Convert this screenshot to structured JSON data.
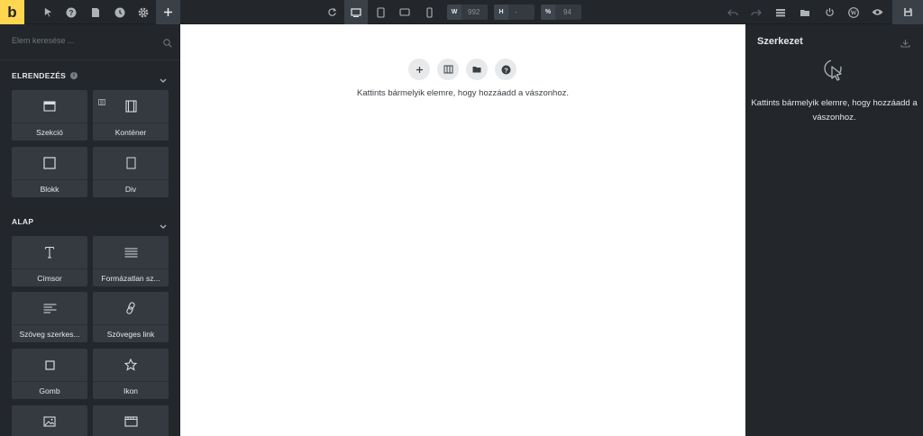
{
  "app": {
    "logo_letter": "b",
    "accent": "#ffd64f"
  },
  "topbar": {
    "left_icons": [
      "pointer-icon",
      "help-icon",
      "pages-icon",
      "history-icon",
      "settings-icon",
      "add-icon"
    ],
    "center_icons": [
      "undo-reload-icon",
      "desktop-icon",
      "tablet-portrait-icon",
      "tablet-landscape-icon",
      "mobile-icon"
    ],
    "width": {
      "label": "W",
      "value": "992"
    },
    "height": {
      "label": "H",
      "value": "-"
    },
    "zoom": {
      "label": "%",
      "value": "94"
    },
    "right_icons": [
      "undo-icon",
      "redo-icon",
      "structure-icon",
      "folder-icon",
      "power-icon",
      "wordpress-icon",
      "preview-icon",
      "save-icon"
    ]
  },
  "sidebar": {
    "search": {
      "placeholder": "Elem keresése ..."
    },
    "sections": [
      {
        "title": "ELRENDEZÉS",
        "items": [
          {
            "label": "Szekció",
            "icon": "section-icon"
          },
          {
            "label": "Konténer",
            "icon": "container-icon"
          },
          {
            "label": "Blokk",
            "icon": "block-icon"
          },
          {
            "label": "Div",
            "icon": "div-icon"
          }
        ]
      },
      {
        "title": "ALAP",
        "items": [
          {
            "label": "Címsor",
            "icon": "heading-icon"
          },
          {
            "label": "Formázatlan sz...",
            "icon": "text-lines-icon"
          },
          {
            "label": "Szöveg szerkes...",
            "icon": "rich-text-icon"
          },
          {
            "label": "Szöveges link",
            "icon": "link-icon"
          },
          {
            "label": "Gomb",
            "icon": "button-icon"
          },
          {
            "label": "Ikon",
            "icon": "star-icon"
          },
          {
            "label": "",
            "icon": "image-icon"
          },
          {
            "label": "",
            "icon": "video-icon"
          }
        ]
      }
    ]
  },
  "canvas": {
    "message": "Kattints bármelyik elemre, hogy hozzáadd a vászonhoz.",
    "actions": [
      "add-icon",
      "columns-icon",
      "folder-icon",
      "help-icon"
    ]
  },
  "structure_panel": {
    "title": "Szerkezet",
    "message": "Kattints bármelyik elemre, hogy hozzáadd a vászonhoz."
  }
}
